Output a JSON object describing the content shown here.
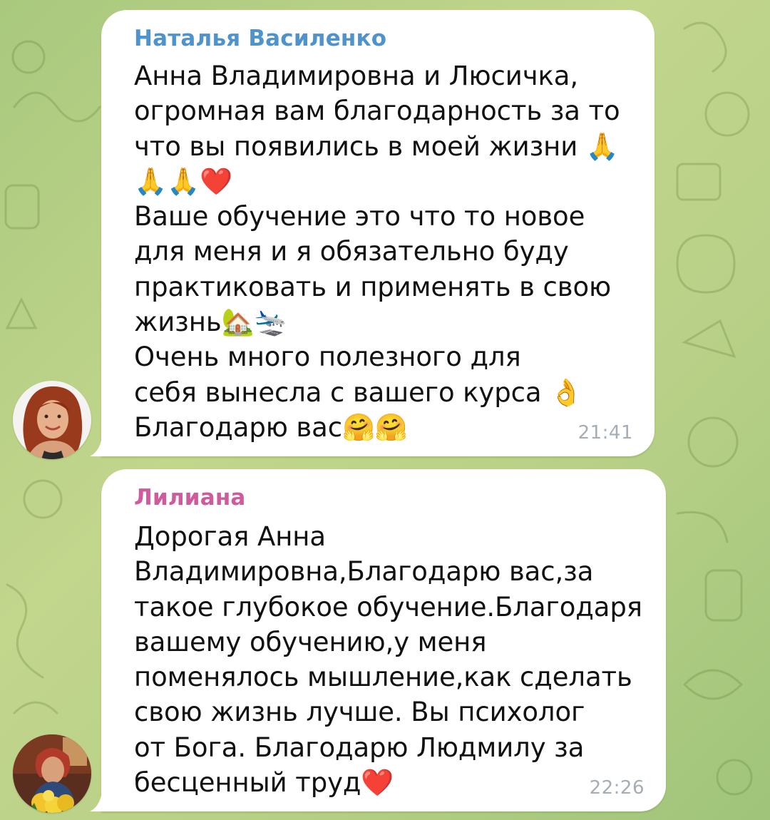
{
  "colors": {
    "wallpaper": "#b6cf86",
    "bubble": "#ffffff",
    "message_text": "#111111",
    "time_text": "#a4aeb4"
  },
  "messages": [
    {
      "sender": "Наталья Василенко",
      "sender_color": "#4f93cc",
      "avatar": "woman-portrait-avatar",
      "text": "Анна Владимировна и Люсичка,\nогромная вам благодарность за то\nчто вы появились в моей жизни 🙏\n🙏🙏❤️\nВаше обучение это что то новое\nдля меня и я обязательно буду\nпрактиковать и применять в свою\nжизнь🏡🛬\nОчень много полезного для\nсебя вынесла с вашего курса 👌\nБлагодарю вас🤗🤗",
      "time": "21:41"
    },
    {
      "sender": "Лилиана",
      "sender_color": "#cf5a9c",
      "avatar": "woman-with-flowers-avatar",
      "text": "Дорогая Анна\nВладимировна,Благодарю вас,за\nтакое глубокое обучение.Благодаря\nвашему обучению,у меня\nпоменялось мышление,как сделать\nсвою жизнь лучше. Вы психолог\nот Бога. Благодарю Людмилу за\nбесценный труд❤️",
      "time": "22:26"
    }
  ]
}
